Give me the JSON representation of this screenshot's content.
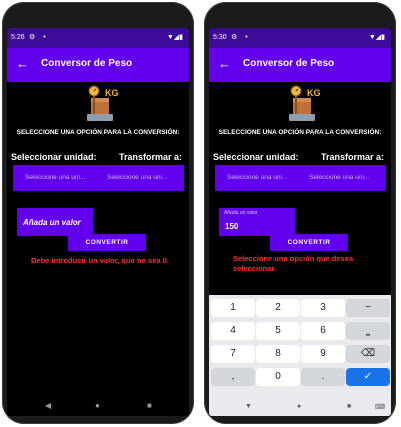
{
  "left_phone": {
    "status_time": "5:26",
    "app_title": "Conversor de Peso",
    "logo_label": "KG",
    "prompt": "SELECCIONE UNA OPCIÓN PARA LA CONVERSIÓN:",
    "label_from": "Seleccionar unidad:",
    "label_to": "Transformar a:",
    "select_from": "Seleccione una uni...",
    "select_to": "Seleccione una uni...",
    "input_hint": "Añada un valor",
    "convert_label": "CONVERTIR",
    "error": "Debe introducir un valor, que no sea 0."
  },
  "right_phone": {
    "status_time": "5:30",
    "app_title": "Conversor de Peso",
    "logo_label": "KG",
    "prompt": "SELECCIONE UNA OPCIÓN PARA LA CONVERSIÓN:",
    "label_from": "Seleccionar unidad:",
    "label_to": "Transformar a:",
    "select_from": "Seleccione una uni...",
    "select_to": "Seleccione una uni...",
    "input_float_label": "Añada un valor",
    "input_value": "150",
    "convert_label": "CONVERTIR",
    "error": "Seleccione una opción que desea seleccionar.",
    "keyboard": {
      "k1": "1",
      "k2": "2",
      "k3": "3",
      "kminus": "−",
      "k4": "4",
      "k5": "5",
      "k6": "6",
      "kspace": "⎵",
      "k7": "7",
      "k8": "8",
      "k9": "9",
      "kback": "⌫",
      "kcomma": ",",
      "k0": "0",
      "kdot": ".",
      "kdone": "✓"
    }
  },
  "colors": {
    "primary": "#6200ee",
    "status": "#3d0a99",
    "error": "#ff3030",
    "done_key": "#1a73e8"
  }
}
